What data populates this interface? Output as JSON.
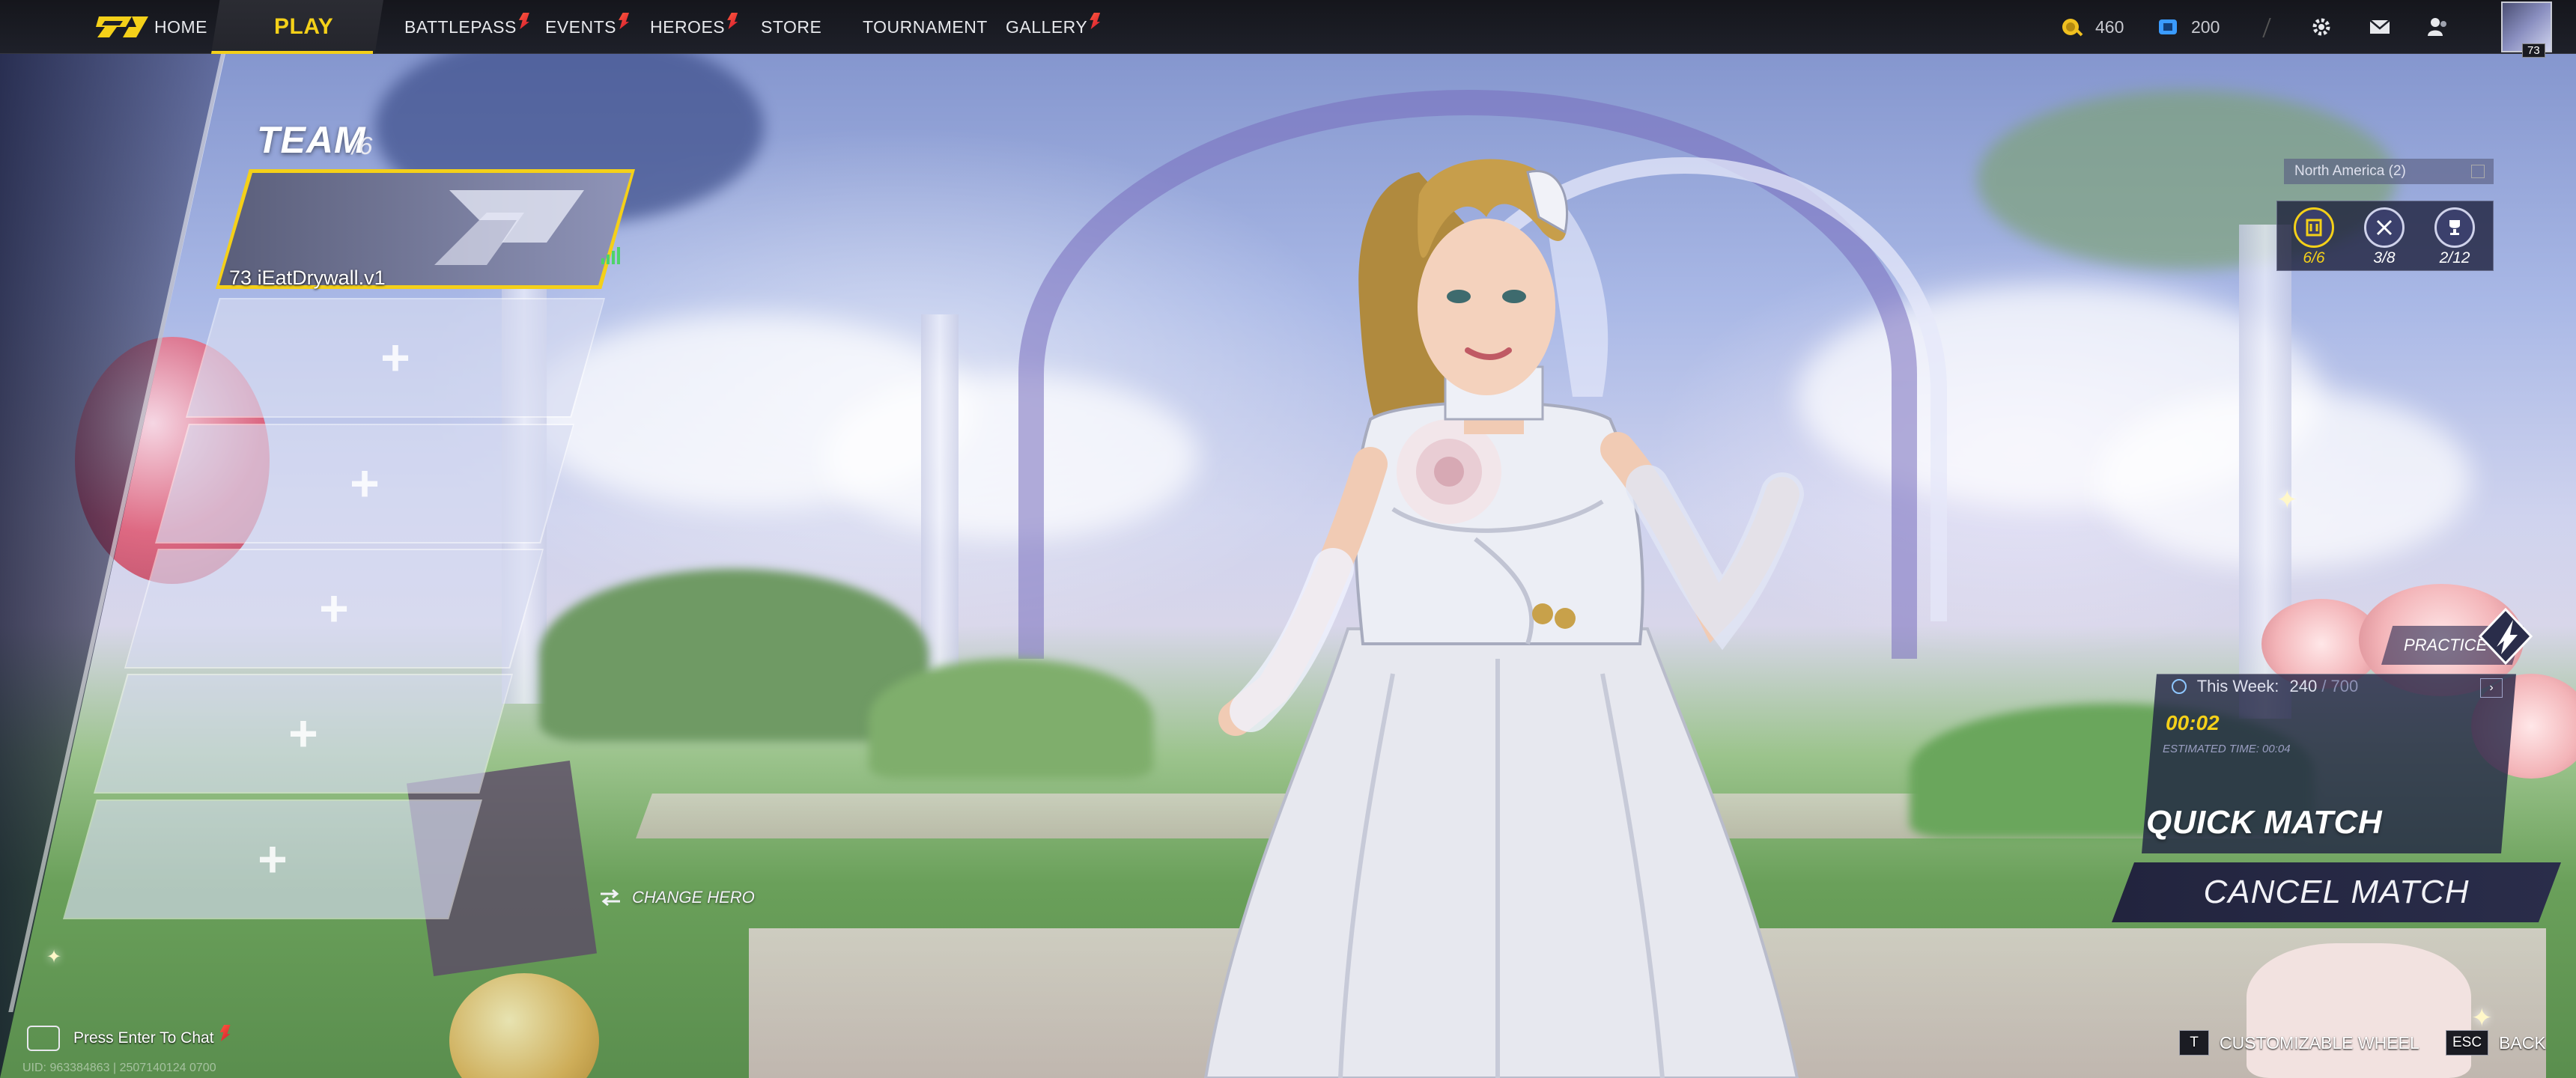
{
  "topbar": {
    "nav": [
      {
        "id": "home",
        "label": "HOME",
        "alert": false
      },
      {
        "id": "play",
        "label": "PLAY",
        "alert": false,
        "active": true
      },
      {
        "id": "battlepass",
        "label": "BATTLEPASS",
        "alert": true
      },
      {
        "id": "events",
        "label": "EVENTS",
        "alert": true
      },
      {
        "id": "heroes",
        "label": "HEROES",
        "alert": true
      },
      {
        "id": "store",
        "label": "STORE",
        "alert": false
      },
      {
        "id": "tournament",
        "label": "TOURNAMENT",
        "alert": false
      },
      {
        "id": "gallery",
        "label": "GALLERY",
        "alert": true
      }
    ],
    "currency_gold": "460",
    "currency_blue": "200",
    "player_level": "73",
    "colors": {
      "accent": "#f4d019",
      "gold": "#f0c020",
      "blue": "#3a9bff"
    }
  },
  "team": {
    "title": "TEAM",
    "count": "/6",
    "player": {
      "level": "73",
      "name": "iEatDrywall.v1"
    },
    "empty_slot_symbol": "+"
  },
  "change_hero": "CHANGE HERO",
  "matchmaking": {
    "region": "North America (2)",
    "modes": [
      {
        "icon": "team-icon",
        "value": "6/6"
      },
      {
        "icon": "crossed-swords-icon",
        "value": "3/8"
      },
      {
        "icon": "trophy-icon",
        "value": "2/12"
      }
    ],
    "practice": "PRACTICE",
    "week_label": "This Week:",
    "week_value": "240",
    "week_max": "/ 700",
    "timer": "00:02",
    "estimated": "ESTIMATED TIME: 00:04",
    "quick_match": "QUICK MATCH",
    "cancel": "CANCEL MATCH"
  },
  "footer": {
    "chat": "Press Enter To Chat",
    "uid": "UID: 963384863 | 2507140124 0700",
    "wheel_key": "T",
    "wheel_label": "CUSTOMIZABLE WHEEL",
    "back_key": "ESC",
    "back_label": "BACK"
  }
}
